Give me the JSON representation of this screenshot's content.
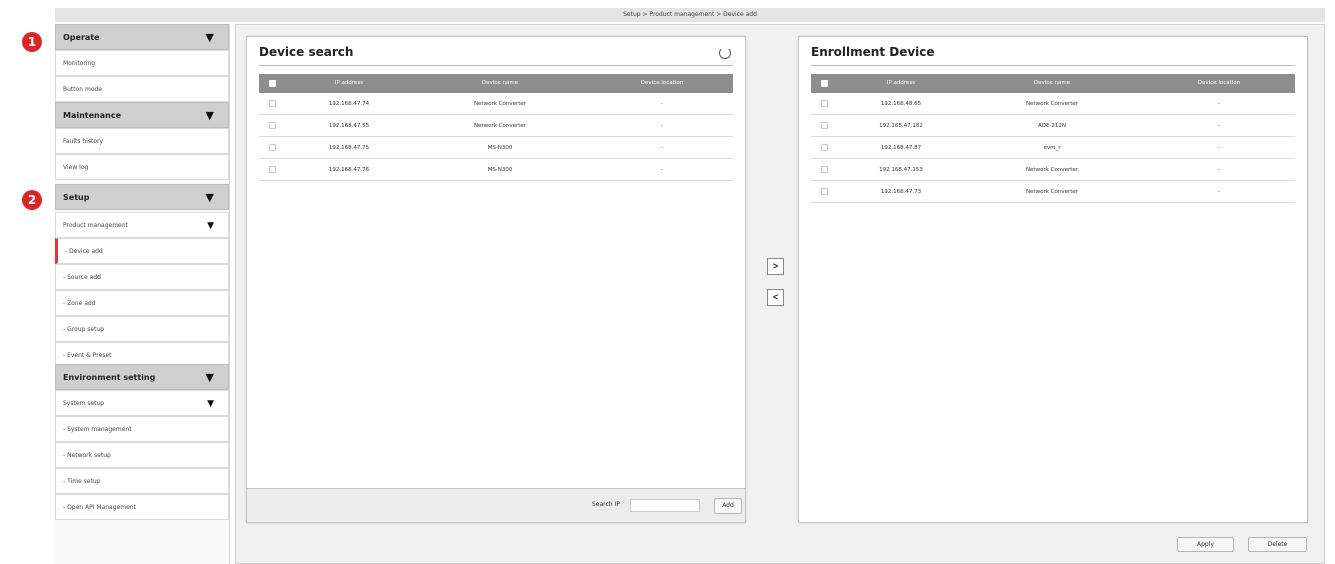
{
  "breadcrumb": "Setup > Product management > Device add",
  "markers": {
    "m1": "1",
    "m2": "2"
  },
  "sidebar": {
    "arrow": "▼",
    "operate": "Operate",
    "monitoring": "Monitoring",
    "button_mode": "Button mode",
    "maintenance": "Maintenance",
    "faults_history": "Faults history",
    "view_log": "View log",
    "setup": "Setup",
    "product_management": "Product management",
    "device_add": "- Device add",
    "source_add": "- Source add",
    "zone_add": "- Zone add",
    "group_setup": "- Group setup",
    "event_preset": "- Event & Preset",
    "environment_setting": "Environment setting",
    "system_setup": "System setup",
    "system_management": "- System management",
    "network_setup": "- Network setup",
    "time_setup": "- Time setup",
    "open_api": "- Open API Management"
  },
  "device_search": {
    "title": "Device search",
    "columns": {
      "ip": "IP address",
      "name": "Device name",
      "loc": "Device location"
    },
    "rows": [
      {
        "ip": "192.168.47.74",
        "name": "Network Converter",
        "loc": "-"
      },
      {
        "ip": "192.168.47.55",
        "name": "Network Converter",
        "loc": "-"
      },
      {
        "ip": "192.168.47.75",
        "name": "MS-N300",
        "loc": "-"
      },
      {
        "ip": "192.168.47.76",
        "name": "MS-N300",
        "loc": "-"
      }
    ],
    "search_label": "Search IP",
    "search_value": "",
    "add_label": "Add"
  },
  "transfer": {
    "to_right": ">",
    "to_left": "<"
  },
  "enrollment": {
    "title": "Enrollment Device",
    "columns": {
      "ip": "IP address",
      "name": "Device name",
      "loc": "Device location"
    },
    "rows": [
      {
        "ip": "192.168.48.65",
        "name": "Network Converter",
        "loc": "-"
      },
      {
        "ip": "192.168.47.182",
        "name": "ADE-212N",
        "loc": "-"
      },
      {
        "ip": "192.168.47.87",
        "name": "evm_r",
        "loc": "-"
      },
      {
        "ip": "192.168.47.153",
        "name": "Network Converter",
        "loc": "-"
      },
      {
        "ip": "192.168.47.73",
        "name": "Network Converter",
        "loc": "-"
      }
    ]
  },
  "actions": {
    "apply": "Apply",
    "delete": "Delete"
  },
  "colors": {
    "accent_red": "#d9262c",
    "header_gray": "#8e8e8e",
    "sidebar_header": "#cfcfcf"
  }
}
